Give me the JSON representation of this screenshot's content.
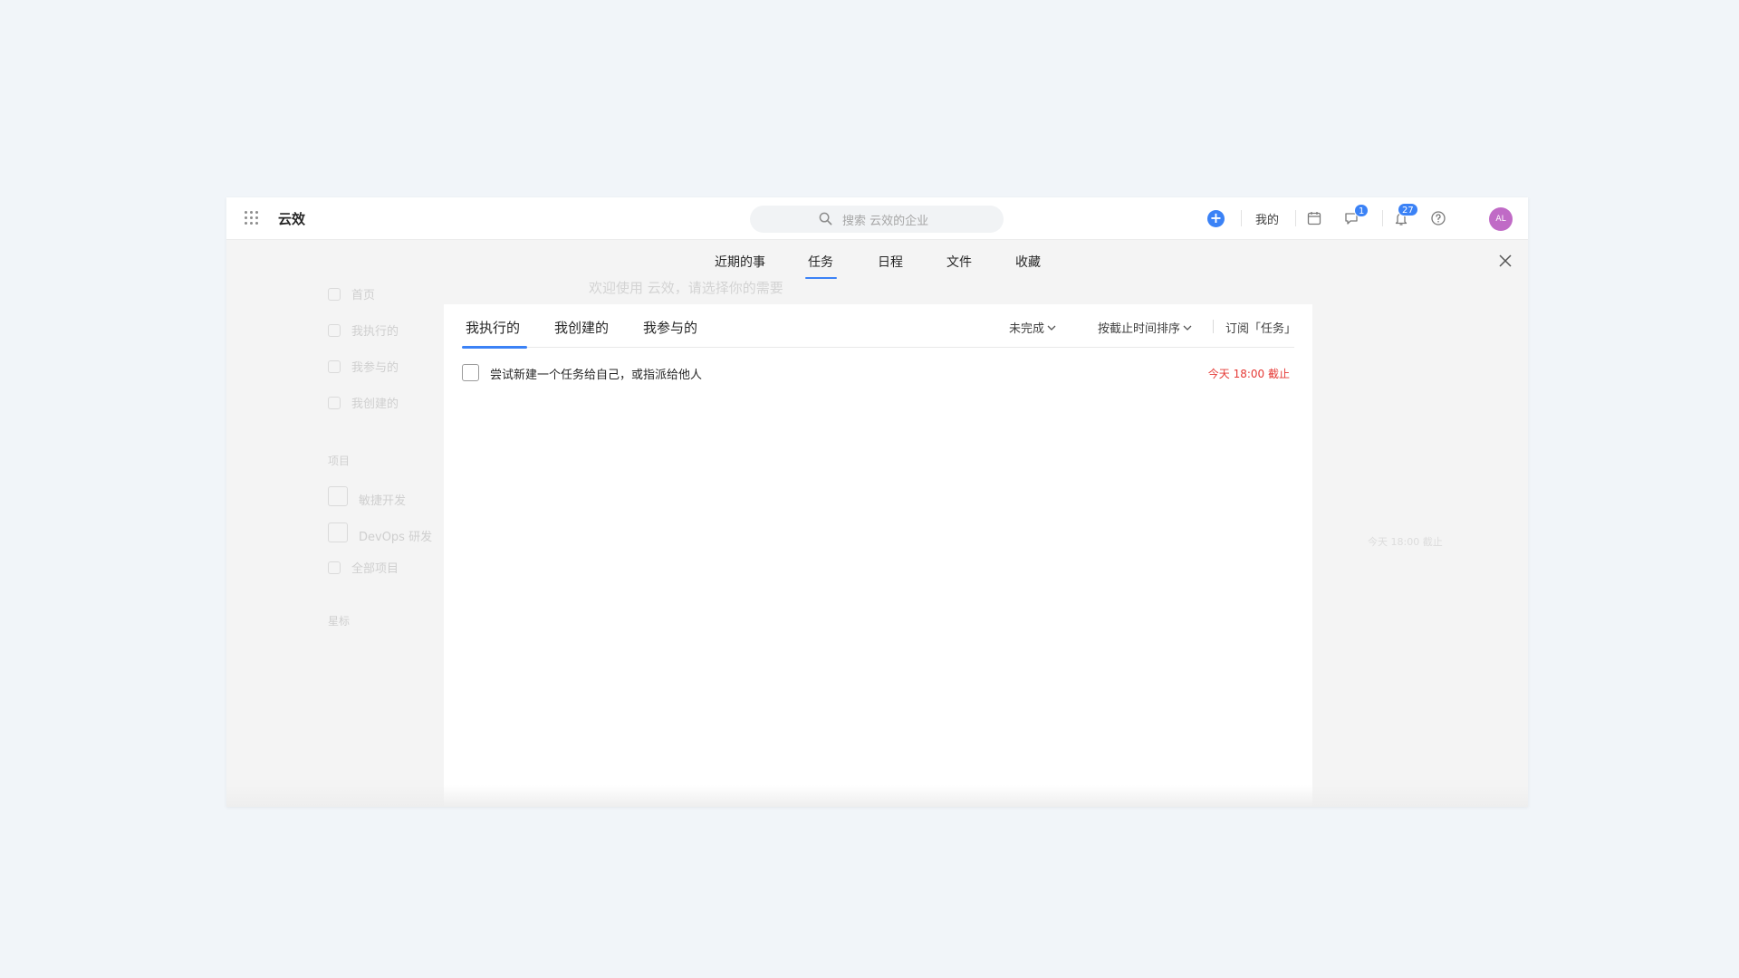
{
  "topbar": {
    "brand": "云效",
    "search_placeholder": "搜索 云效的企业",
    "mine_label": "我的",
    "chat_badge": "1",
    "notify_badge": "27",
    "avatar_initials": "AL"
  },
  "overlay_tabs": [
    "近期的事",
    "任务",
    "日程",
    "文件",
    "收藏"
  ],
  "active_overlay_tab": "任务",
  "panel": {
    "tabs": [
      "我执行的",
      "我创建的",
      "我参与的"
    ],
    "active_tab": "我执行的",
    "status_filter": "未完成",
    "sort_filter": "按截止时间排序",
    "subscribe": "订阅「任务」"
  },
  "tasks": [
    {
      "title": "尝试新建一个任务给自己，或指派给他人",
      "due": "今天 18:00 截止",
      "done": false
    }
  ],
  "colors": {
    "accent": "#3b82f6",
    "due_red": "#e53935",
    "avatar": "#c06ac6"
  }
}
